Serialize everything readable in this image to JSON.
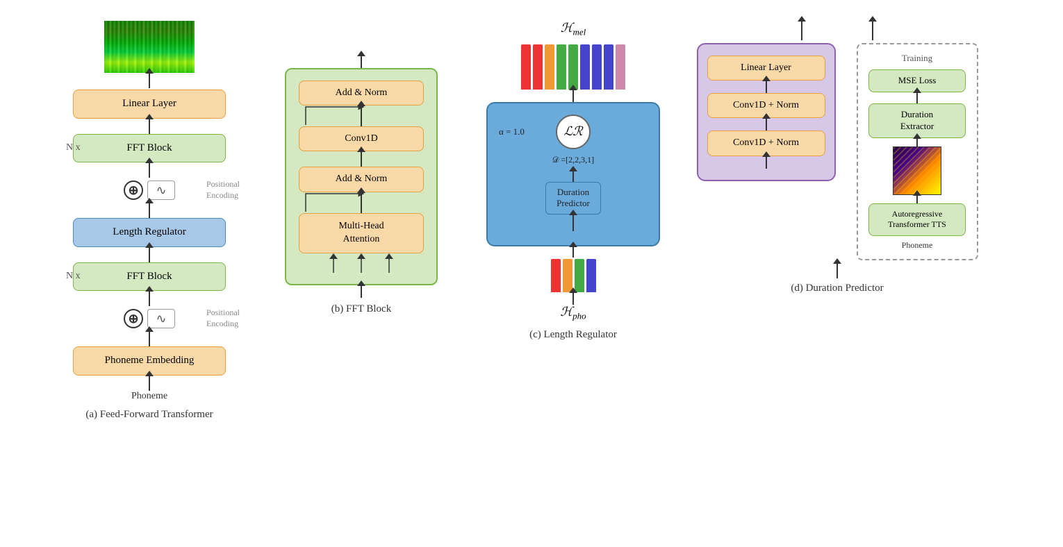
{
  "sections": {
    "a": {
      "caption": "(a) Feed-Forward Transformer",
      "spectrogram_alt": "Mel Spectrogram Output",
      "linear_layer": "Linear Layer",
      "fft_block_top": "FFT Block",
      "positional_encoding_1": "Positional\nEncoding",
      "length_regulator": "Length Regulator",
      "fft_block_bottom": "FFT Block",
      "positional_encoding_2": "Positional\nEncoding",
      "phoneme_embedding": "Phoneme Embedding",
      "phoneme_label": "Phoneme",
      "nx_label_top": "N x",
      "nx_label_bottom": "N x"
    },
    "b": {
      "caption": "(b) FFT Block",
      "add_norm_top": "Add & Norm",
      "conv1d": "Conv1D",
      "add_norm_bottom": "Add & Norm",
      "multi_head": "Multi-Head\nAttention"
    },
    "c": {
      "caption": "(c) Length Regulator",
      "h_mel": "ℋ_mel",
      "h_mel_italic": "mel",
      "h_pho": "ℋ_pho",
      "h_pho_italic": "pho",
      "lr_symbol": "ℒℛ",
      "alpha_label": "α = 1.0",
      "duration_label": "𝒟 =[2,2,3,1]",
      "duration_predictor": "Duration\nPredictor"
    },
    "d": {
      "caption": "(d) Duration Predictor",
      "linear_layer": "Linear Layer",
      "conv1d_norm_top": "Conv1D + Norm",
      "conv1d_norm_bottom": "Conv1D + Norm",
      "training_label": "Training",
      "mse_loss": "MSE Loss",
      "duration_extractor": "Duration\nExtractor",
      "autoregressive": "Autoregressive\nTransformer TTS",
      "phoneme_label": "Phoneme"
    }
  },
  "colors": {
    "orange_bg": "#f9d9a8",
    "orange_border": "#e8a040",
    "green_bg": "#d4e8c2",
    "green_border": "#7ab648",
    "blue_bg": "#6aabdc",
    "blue_border": "#3a7aaa",
    "purple_bg": "#d8c8e8",
    "purple_border": "#9060b0"
  }
}
